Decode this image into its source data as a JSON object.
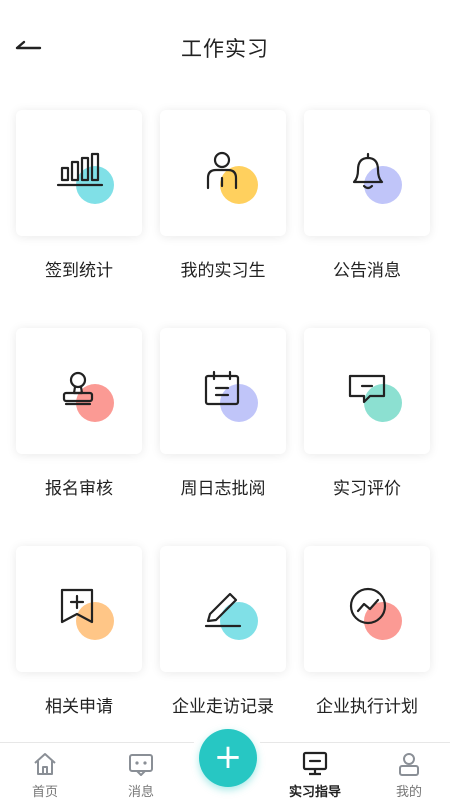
{
  "header": {
    "title": "工作实习",
    "back_icon": "arrow-left-icon"
  },
  "grid": [
    {
      "label": "签到统计",
      "icon": "bar-chart-icon",
      "accent": "#72dde4"
    },
    {
      "label": "我的实习生",
      "icon": "person-icon",
      "accent": "#ffcb4d"
    },
    {
      "label": "公告消息",
      "icon": "bell-icon",
      "accent": "#b9bff8"
    },
    {
      "label": "报名审核",
      "icon": "stamp-icon",
      "accent": "#fb8f88"
    },
    {
      "label": "周日志批阅",
      "icon": "calendar-icon",
      "accent": "#b9bff8"
    },
    {
      "label": "实习评价",
      "icon": "comment-icon",
      "accent": "#80ddcc"
    },
    {
      "label": "相关申请",
      "icon": "flag-plus-icon",
      "accent": "#ffc07a"
    },
    {
      "label": "企业走访记录",
      "icon": "pencil-icon",
      "accent": "#72dde4"
    },
    {
      "label": "企业执行计划",
      "icon": "trend-circle-icon",
      "accent": "#fb8f88"
    }
  ],
  "tabbar": {
    "items": [
      {
        "label": "首页",
        "icon": "home-icon",
        "active": false
      },
      {
        "label": "消息",
        "icon": "message-icon",
        "active": false
      },
      {
        "label": "实习指导",
        "icon": "monitor-icon",
        "active": true
      },
      {
        "label": "我的",
        "icon": "user-icon",
        "active": false
      }
    ],
    "fab_label": "+",
    "fab_color": "#27c7c3"
  }
}
